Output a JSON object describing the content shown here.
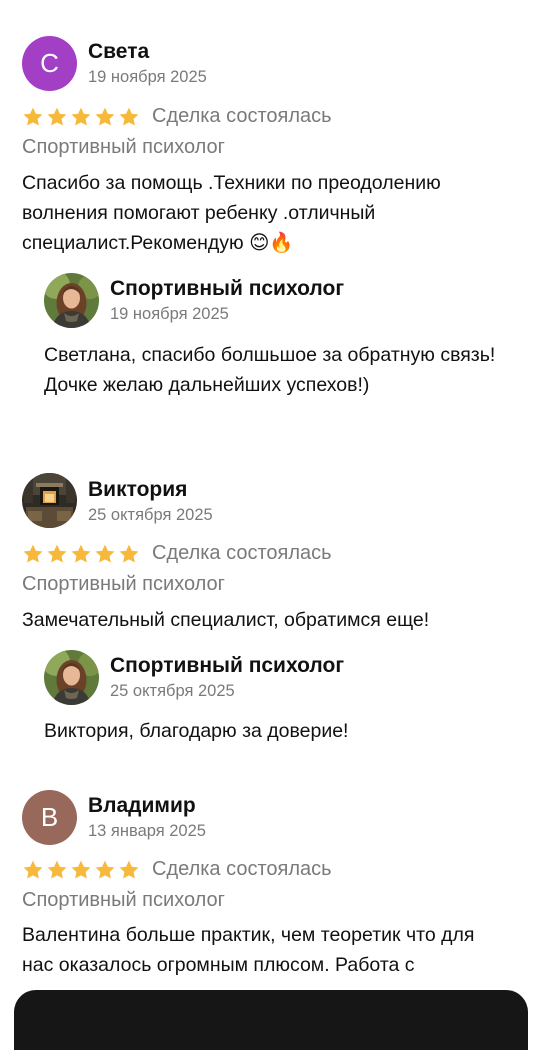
{
  "colors": {
    "star": "#f6b93b",
    "avatar_sveta": "#a23fc4",
    "avatar_vladimir": "#98695a",
    "muted_text": "#7a7a7a"
  },
  "reviews": [
    {
      "author_initial": "С",
      "author_name": "Света",
      "date": "19 ноября 2025",
      "rating": 5,
      "deal_status": "Сделка состоялась",
      "service": "Спортивный психолог",
      "text": "Спасибо за помощь .Техники по преодолению волнения помогают ребенку .отличный специалист.Рекомендую ",
      "emojis": "😊🔥",
      "reply": {
        "author_name": "Спортивный психолог",
        "date": "19 ноября 2025",
        "text_lines": [
          "Светлана, спасибо болшьшое за обратную связь!",
          "Дочке желаю дальнейших успехов!)"
        ]
      }
    },
    {
      "author_name": "Виктория",
      "date": "25 октября 2025",
      "rating": 5,
      "deal_status": "Сделка состоялась",
      "service": "Спортивный психолог",
      "text": "Замечательный специалист, обратимся еще!",
      "reply": {
        "author_name": "Спортивный психолог",
        "date": "25 октября 2025",
        "text_lines": [
          "Виктория, благодарю за доверие!"
        ]
      }
    },
    {
      "author_initial": "В",
      "author_name": "Владимир",
      "date": "13 января 2025",
      "rating": 5,
      "deal_status": "Сделка состоялась",
      "service": "Спортивный психолог",
      "text": "Валентина больше практик, чем теоретик что для нас оказалось огромным плюсом. Работа с"
    }
  ]
}
